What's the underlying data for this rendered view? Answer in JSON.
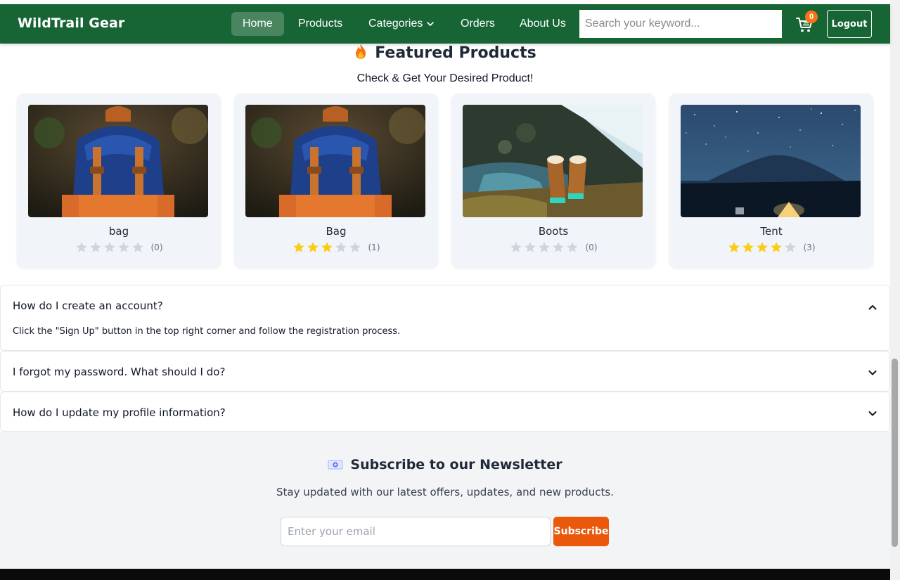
{
  "navbar": {
    "brand": "WildTrail Gear",
    "links": {
      "home": "Home",
      "products": "Products",
      "categories": "Categories",
      "orders": "Orders",
      "about": "About Us"
    },
    "active": "Home",
    "search_placeholder": "Search your keyword...",
    "cart_count": "0",
    "logout": "Logout",
    "bg_color": "#176434"
  },
  "featured": {
    "icon": "fire-icon",
    "title": "Featured Products",
    "subtitle": "Check & Get Your Desired Product!",
    "products": [
      {
        "name": "bag",
        "rating": 0,
        "count": "(0)",
        "image": "backpack-photo"
      },
      {
        "name": "Bag",
        "rating": 3,
        "count": "(1)",
        "image": "backpack-photo"
      },
      {
        "name": "Boots",
        "rating": 0,
        "count": "(0)",
        "image": "hiking-boots-photo"
      },
      {
        "name": "Tent",
        "rating": 4,
        "count": "(3)",
        "image": "tent-night-sky-photo"
      }
    ]
  },
  "faq": [
    {
      "question": "How do I create an account?",
      "answer": "Click the \"Sign Up\" button in the top right corner and follow the registration process.",
      "expanded": true
    },
    {
      "question": "I forgot my password. What should I do?",
      "expanded": false
    },
    {
      "question": "How do I update my profile information?",
      "expanded": false
    }
  ],
  "newsletter": {
    "icon": "envelope-icon",
    "title": "Subscribe to our Newsletter",
    "subtitle": "Stay updated with our latest offers, updates, and new products.",
    "email_placeholder": "Enter your email",
    "button": "Subscribe",
    "button_color": "#ea580c"
  },
  "colors": {
    "star_filled": "#facc15",
    "star_empty": "#d1d5db"
  }
}
